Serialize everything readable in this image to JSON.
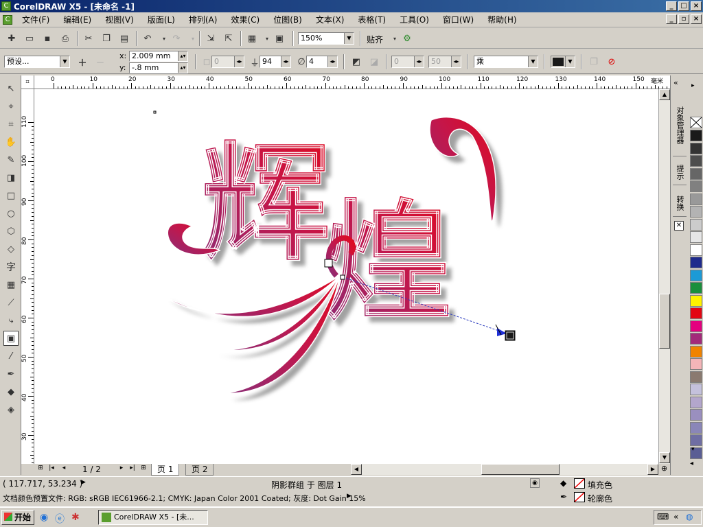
{
  "window": {
    "title": "CorelDRAW X5 - [未命名 -1]",
    "icon": "coreldraw-icon"
  },
  "menu": [
    "文件(F)",
    "编辑(E)",
    "视图(V)",
    "版面(L)",
    "排列(A)",
    "效果(C)",
    "位图(B)",
    "文本(X)",
    "表格(T)",
    "工具(O)",
    "窗口(W)",
    "帮助(H)"
  ],
  "toolbar1": {
    "zoom": "150%",
    "snap": "贴齐"
  },
  "property_bar": {
    "preset": "预设...",
    "x_label": "x:",
    "x_value": "2.009 mm",
    "y_label": "y:",
    "y_value": "-.8 mm",
    "angle_value": "0",
    "opacity_value": "94",
    "feather_value": "4",
    "fade_value": "0",
    "stretch_value": "50",
    "blend_mode": "乘"
  },
  "rulers": {
    "unit": "毫米",
    "h_ticks": [
      "0",
      "10",
      "20",
      "30",
      "40",
      "50",
      "60",
      "70",
      "80",
      "90",
      "100",
      "110",
      "120",
      "130",
      "140",
      "150"
    ],
    "v_ticks": [
      "110",
      "100",
      "90",
      "80",
      "70",
      "60",
      "50",
      "40",
      "30"
    ]
  },
  "canvas": {
    "artwork_text": [
      "辉",
      "煌"
    ]
  },
  "page_nav": {
    "counter": "1 / 2",
    "pages": [
      "页 1",
      "页 2"
    ]
  },
  "dockers": [
    "对象管理器",
    "提示",
    "转换"
  ],
  "palette": [
    "#ffffff",
    "#1a1a1a",
    "#333333",
    "#4d4d4d",
    "#666666",
    "#808080",
    "#999999",
    "#b3b3b3",
    "#cccccc",
    "#e6e6e6",
    "#ffffff",
    "#1e2a8c",
    "#1c9ad6",
    "#1a8f3c",
    "#fff200",
    "#e30613",
    "#e4007f",
    "#a3297a",
    "#f08300",
    "#f4b5b8",
    "#8a7a70",
    "#c4c1dc",
    "#b3a6cc",
    "#9a8fbf",
    "#8a86b8",
    "#6f6ea3",
    "#5a5e94"
  ],
  "status": {
    "coords": "( 117.717, 53.234 )",
    "selection": "阴影群组 于 图层 1",
    "color_profile": "文档颜色预置文件: RGB: sRGB IEC61966-2.1; CMYK: Japan Color 2001 Coated; 灰度: Dot Gain 15%",
    "fill_label": "填充色",
    "outline_label": "轮廓色"
  },
  "taskbar": {
    "start": "开始",
    "task": "CorelDRAW X5 - [未..."
  }
}
